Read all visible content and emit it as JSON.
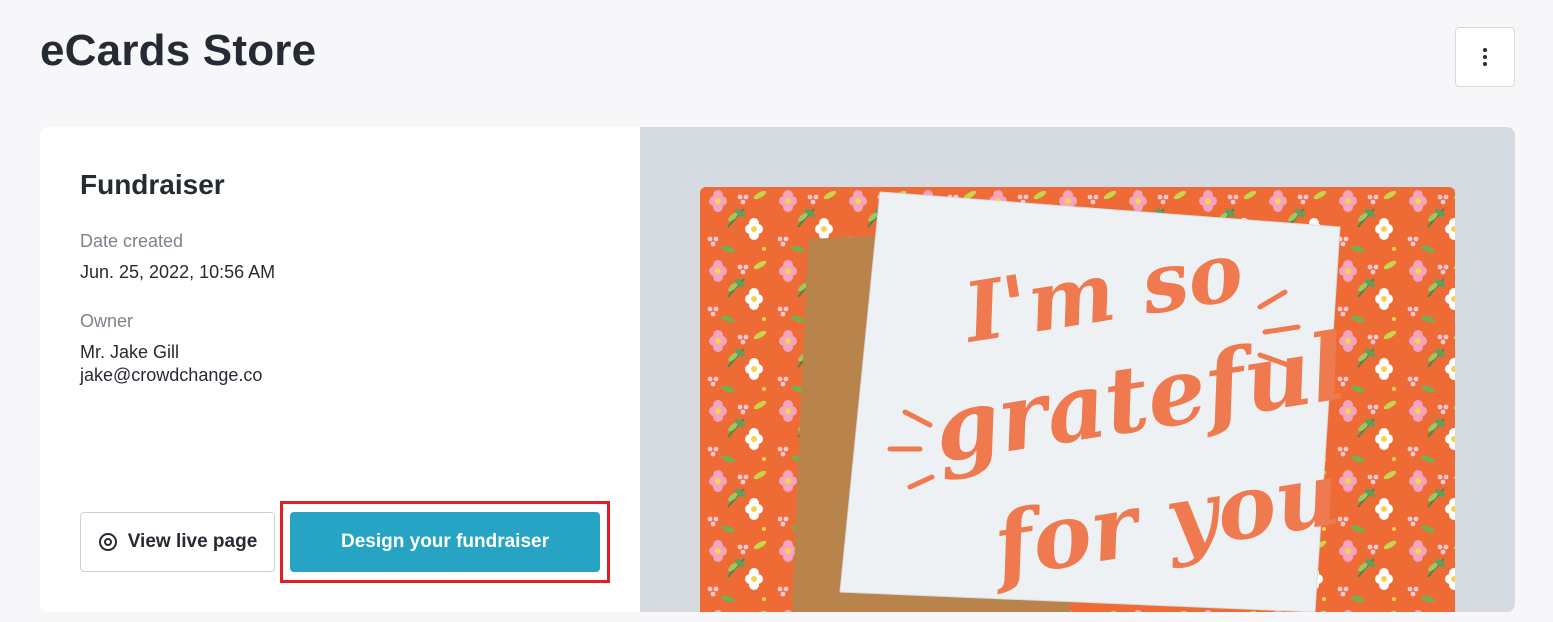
{
  "page": {
    "title": "eCards Store"
  },
  "header": {
    "more_icon": "vertical-ellipsis-icon"
  },
  "fundraiser": {
    "title": "Fundraiser",
    "date_created_label": "Date created",
    "date_created_value": "Jun. 25, 2022, 10:56 AM",
    "owner_label": "Owner",
    "owner_name": "Mr. Jake Gill",
    "owner_email": "jake@crowdchange.co"
  },
  "actions": {
    "view_live_label": "View live page",
    "view_live_icon": "eye-icon",
    "design_label": "Design your fundraiser"
  },
  "ecard": {
    "text_line_1": "I'm so",
    "text_line_2": "grateful",
    "text_line_3": "for you"
  },
  "colors": {
    "primary": "#27a3c4",
    "highlight": "#e01e27",
    "card_orange": "#ee6b36",
    "lettering": "#ef7a4f",
    "panel_bg": "#d6dae1"
  }
}
